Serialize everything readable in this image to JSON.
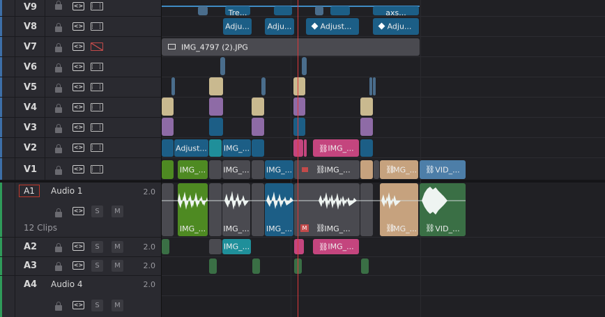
{
  "tracks": {
    "video": [
      {
        "id": "V9",
        "label": "V9"
      },
      {
        "id": "V8",
        "label": "V8"
      },
      {
        "id": "V7",
        "label": "V7"
      },
      {
        "id": "V6",
        "label": "V6"
      },
      {
        "id": "V5",
        "label": "V5"
      },
      {
        "id": "V4",
        "label": "V4"
      },
      {
        "id": "V3",
        "label": "V3"
      },
      {
        "id": "V2",
        "label": "V2"
      },
      {
        "id": "V1",
        "label": "V1"
      }
    ],
    "audio": [
      {
        "id": "A1",
        "label": "A1",
        "name": "Audio 1",
        "channel": "2.0",
        "clips_count": "12 Clips"
      },
      {
        "id": "A2",
        "label": "A2",
        "channel": "2.0"
      },
      {
        "id": "A3",
        "label": "A3",
        "channel": "2.0"
      },
      {
        "id": "A4",
        "label": "A4",
        "name": "Audio 4",
        "channel": "2.0"
      }
    ]
  },
  "buttons": {
    "solo": "S",
    "mute": "M",
    "auto_select": "<>"
  },
  "clips": {
    "v9_a": "Tre...",
    "v9_b": "axs...",
    "v8_a": "Adju...",
    "v8_b": "Adju...",
    "v8_c": "Adjust...",
    "v8_d": "Adju...",
    "v7_a": "IMG_4797 (2).JPG",
    "v2_a": "Adjust...",
    "v2_b": "IMG_...",
    "v2_c": "IMG_...",
    "v1_a": "IMG_...",
    "v1_b": "IMG_...",
    "v1_c": "IMG_...",
    "v1_d": "IMG_...",
    "v1_e": "IMG_...",
    "v1_f": "VID_...",
    "a1_a": "IMG_...",
    "a1_b": "IMG_...",
    "a1_c": "IMG_...",
    "a1_d": "IMG_...",
    "a1_e": "IMG_...",
    "a1_f": "VID_...",
    "a2_a": "IMG_...",
    "a2_b": "IMG_...",
    "marker": "M"
  },
  "colors": {
    "blue": "#1c5e86",
    "teal": "#1f8f9a",
    "purple": "#8e6ba6",
    "tan": "#c9b98f",
    "beige": "#c6a27e",
    "green": "#4e8a22",
    "darkgreen": "#3a6f45",
    "pink": "#c4457e",
    "gray": "#4a4a50",
    "slate": "#4a6d8c",
    "lightblue": "#4d7ea8",
    "playhead": "#e0383b"
  }
}
